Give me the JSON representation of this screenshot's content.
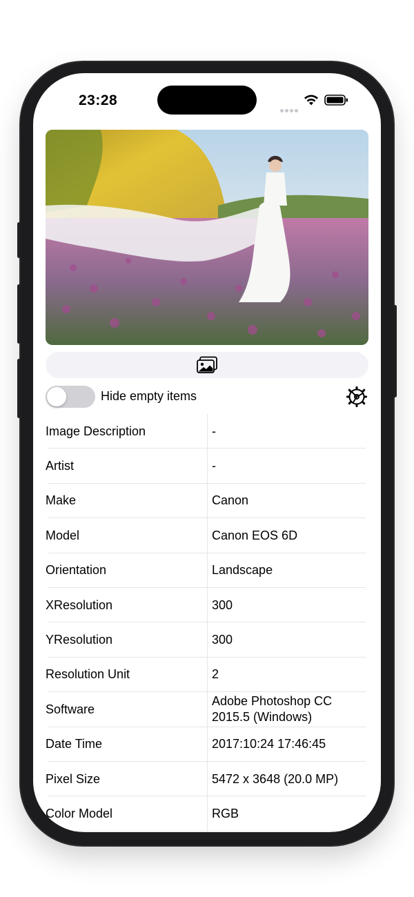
{
  "status_bar": {
    "time": "23:28"
  },
  "photo": {
    "description": "Photo of a bride in a white gown standing in a field of purple flowers"
  },
  "controls": {
    "hide_empty_label": "Hide empty items",
    "hide_empty_on": false
  },
  "exif_rows": [
    {
      "key": "Image Description",
      "value": "-"
    },
    {
      "key": "Artist",
      "value": "-"
    },
    {
      "key": "Make",
      "value": "Canon"
    },
    {
      "key": "Model",
      "value": "Canon EOS 6D"
    },
    {
      "key": "Orientation",
      "value": "Landscape"
    },
    {
      "key": "XResolution",
      "value": "300"
    },
    {
      "key": "YResolution",
      "value": "300"
    },
    {
      "key": "Resolution Unit",
      "value": "2"
    },
    {
      "key": "Software",
      "value": "Adobe Photoshop CC 2015.5 (Windows)"
    },
    {
      "key": "Date Time",
      "value": "2017:10:24 17:46:45"
    },
    {
      "key": "Pixel Size",
      "value": "5472 x 3648 (20.0 MP)"
    },
    {
      "key": "Color Model",
      "value": "RGB"
    }
  ],
  "icons": {
    "photo_picker": "photo-library-icon",
    "settings": "gear-icon",
    "wifi": "wifi-icon",
    "battery": "battery-icon"
  },
  "colors": {
    "toggle_off": "#d1d1d6",
    "button_bg": "#f2f2f7",
    "separator": "#e5e5ea"
  }
}
